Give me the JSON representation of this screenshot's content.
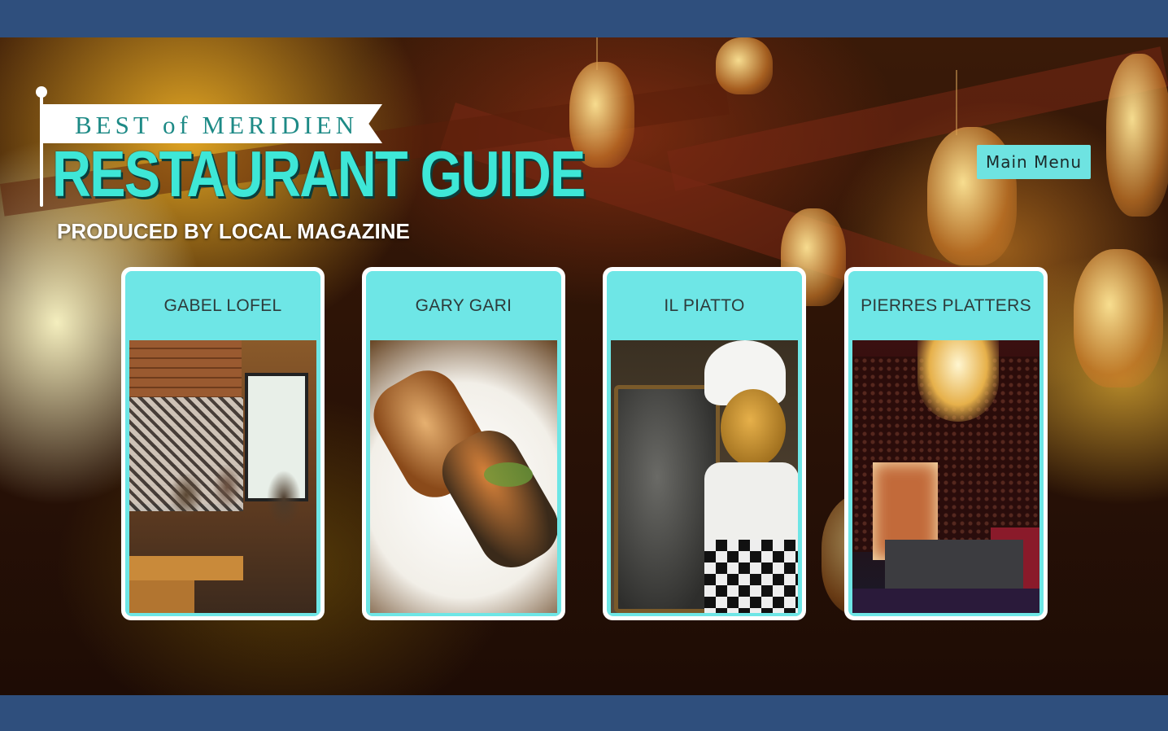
{
  "logo": {
    "tagline": "BEST of MERIDIEN",
    "title": "RESTAURANT GUIDE",
    "subtitle": "PRODUCED BY LOCAL MAGAZINE"
  },
  "nav": {
    "main_menu_label": "Main Menu"
  },
  "restaurants": [
    {
      "name": "GABEL LOFEL"
    },
    {
      "name": "GARY GARI"
    },
    {
      "name": "IL PIATTO"
    },
    {
      "name": "PIERRES PLATTERS"
    }
  ],
  "colors": {
    "frame_blue": "#2f4f7d",
    "accent_teal": "#6ee6e6",
    "logo_teal": "#3ee7d7"
  }
}
